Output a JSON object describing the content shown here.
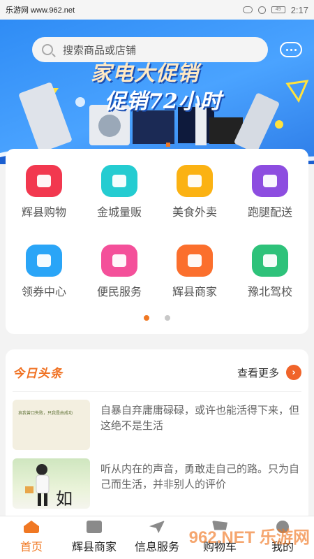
{
  "status_bar": {
    "site": "乐游网 www.962.net",
    "time": "2:17",
    "battery": "49"
  },
  "banner": {
    "line1": "家电大促销",
    "line2": "促销72小时"
  },
  "search": {
    "placeholder": "搜索商品或店铺"
  },
  "categories": [
    {
      "label": "辉县购物",
      "icon": "shopping-bag-icon",
      "color": "#f2384f"
    },
    {
      "label": "金城量贩",
      "icon": "tag-icon",
      "color": "#24ccd1"
    },
    {
      "label": "美食外卖",
      "icon": "scooter-icon",
      "color": "#fbb213"
    },
    {
      "label": "跑腿配送",
      "icon": "runner-icon",
      "color": "#8d4de0"
    },
    {
      "label": "领券中心",
      "icon": "coupon-icon",
      "color": "#2aa5f7"
    },
    {
      "label": "便民服务",
      "icon": "ticket-icon",
      "color": "#f4509a"
    },
    {
      "label": "辉县商家",
      "icon": "store-icon",
      "color": "#fb6f2d"
    },
    {
      "label": "豫北驾校",
      "icon": "driver-icon",
      "color": "#2ec27a"
    }
  ],
  "pager": {
    "pages": 2,
    "active": 0
  },
  "news": {
    "title": "今日头条",
    "more_label": "查看更多",
    "more_arrow": "›",
    "items": [
      {
        "text": "自暴自弃庸庸碌碌，或许也能活得下来，但这绝不是生活",
        "thumb_caption": "哀我曾口失败，只我是由成功"
      },
      {
        "text": "听从内在的声音，勇敢走自己的路。只为自己而生活，并非别人的评价",
        "thumb_caption": "如"
      }
    ]
  },
  "tabs": [
    {
      "label": "首页",
      "icon": "home-icon",
      "active": true
    },
    {
      "label": "辉县商家",
      "icon": "store-icon",
      "active": false
    },
    {
      "label": "信息服务",
      "icon": "send-icon",
      "active": false
    },
    {
      "label": "购物车",
      "icon": "cart-icon",
      "active": false
    },
    {
      "label": "我的",
      "icon": "user-icon",
      "active": false
    }
  ],
  "watermark": "962.NET 乐游网"
}
